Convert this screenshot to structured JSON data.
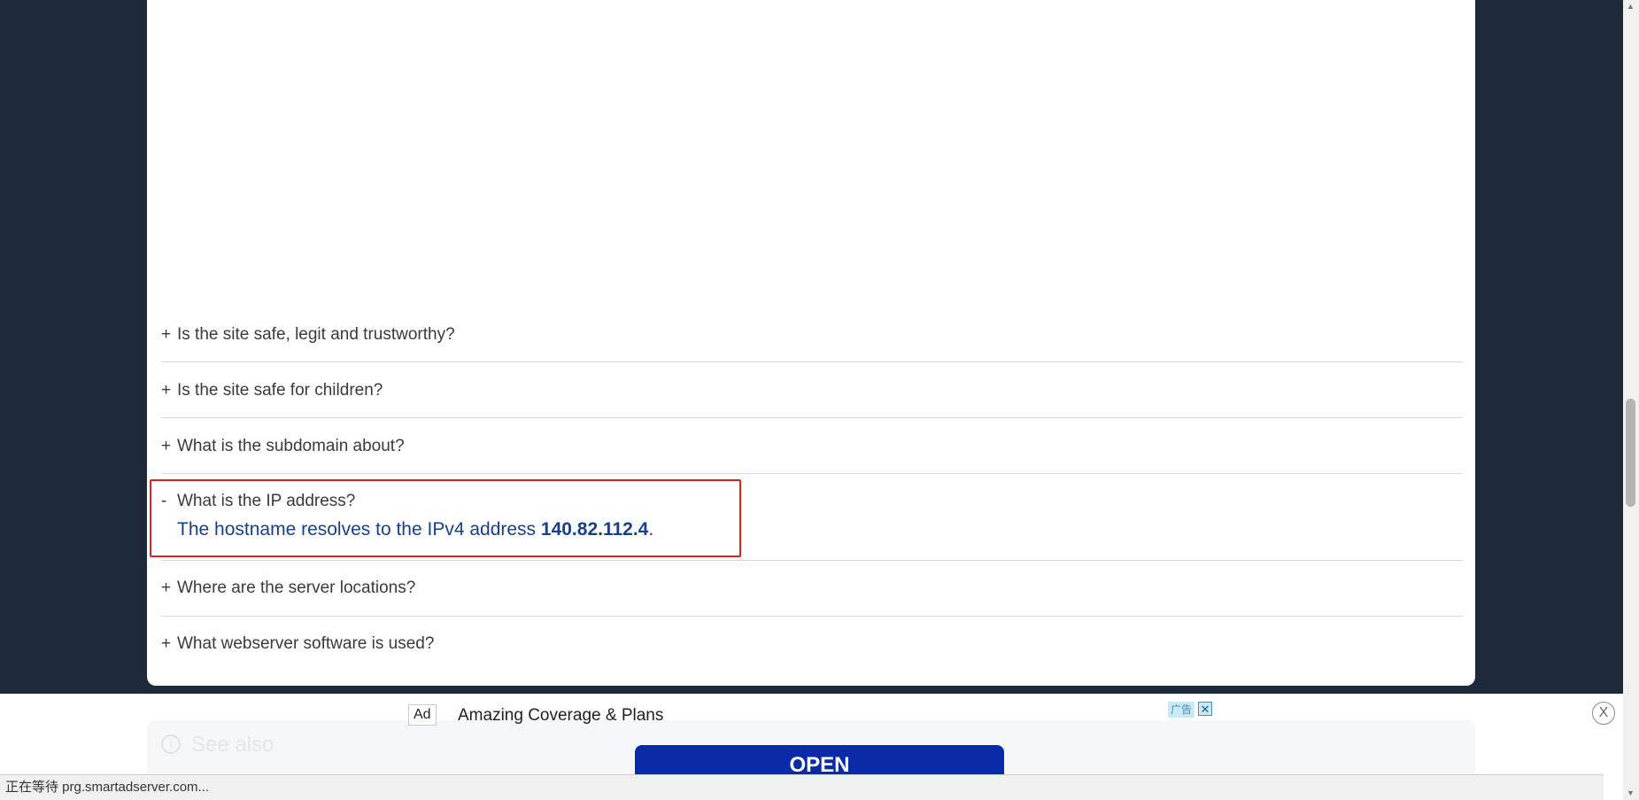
{
  "faq": {
    "items": [
      {
        "sign": "+",
        "question": "Is the site safe, legit and trustworthy?"
      },
      {
        "sign": "+",
        "question": "Is the site safe for children?"
      },
      {
        "sign": "+",
        "question": "What is the subdomain about?"
      },
      {
        "sign": "-",
        "question": "What is the IP address?"
      },
      {
        "sign": "+",
        "question": "Where are the server locations?"
      },
      {
        "sign": "+",
        "question": "What webserver software is used?"
      }
    ],
    "answer": {
      "prefix": "The hostname resolves to the IPv4 address ",
      "ip": "140.82.112.4",
      "suffix": "."
    }
  },
  "see_also": {
    "icon": "info-icon",
    "title": "See also"
  },
  "ad": {
    "badge": "Ad",
    "title": "Amazing Coverage & Plans",
    "label_cn": "广告",
    "close_small": "✕",
    "open_label": "OPEN",
    "close_label": "X"
  },
  "status_bar": {
    "text": "正在等待 prg.smartadserver.com..."
  },
  "colors": {
    "page_bg": "#1e2939",
    "answer_text": "#173f8a",
    "highlight": "#e0201e",
    "ad_button": "#0a2aa8"
  }
}
